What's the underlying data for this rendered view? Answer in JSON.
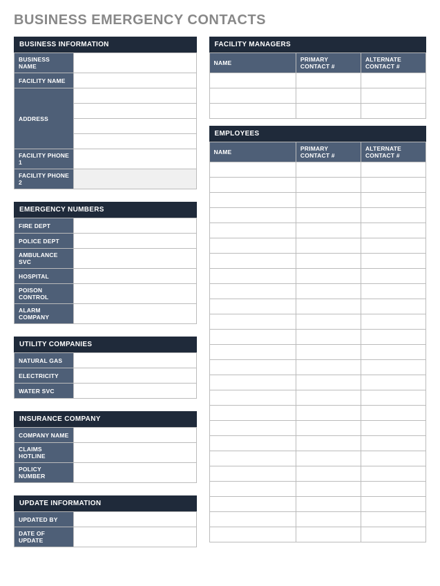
{
  "page_title": "BUSINESS EMERGENCY CONTACTS",
  "left": {
    "business_info": {
      "header": "BUSINESS INFORMATION",
      "rows": [
        {
          "label": "BUSINESS NAME",
          "value": ""
        },
        {
          "label": "FACILITY NAME",
          "value": ""
        },
        {
          "label": "ADDRESS",
          "value": [
            "",
            "",
            "",
            ""
          ]
        },
        {
          "label": "FACILITY PHONE 1",
          "value": ""
        },
        {
          "label": "FACILITY PHONE 2",
          "value": "",
          "shaded": true
        }
      ]
    },
    "emergency_numbers": {
      "header": "EMERGENCY NUMBERS",
      "rows": [
        {
          "label": "FIRE DEPT",
          "value": ""
        },
        {
          "label": "POLICE DEPT",
          "value": ""
        },
        {
          "label": "AMBULANCE SVC",
          "value": ""
        },
        {
          "label": "HOSPITAL",
          "value": ""
        },
        {
          "label": "POISON CONTROL",
          "value": ""
        },
        {
          "label": "ALARM COMPANY",
          "value": ""
        }
      ]
    },
    "utility_companies": {
      "header": "UTILITY COMPANIES",
      "rows": [
        {
          "label": "NATURAL GAS",
          "value": ""
        },
        {
          "label": "ELECTRICITY",
          "value": ""
        },
        {
          "label": "WATER SVC",
          "value": ""
        }
      ]
    },
    "insurance_company": {
      "header": "INSURANCE COMPANY",
      "rows": [
        {
          "label": "COMPANY NAME",
          "value": ""
        },
        {
          "label": "CLAIMS HOTLINE",
          "value": ""
        },
        {
          "label": "POLICY NUMBER",
          "value": ""
        }
      ]
    },
    "update_information": {
      "header": "UPDATE INFORMATION",
      "rows": [
        {
          "label": "UPDATED BY",
          "value": ""
        },
        {
          "label": "DATE OF UPDATE",
          "value": ""
        }
      ]
    }
  },
  "right": {
    "facility_managers": {
      "header": "FACILITY MANAGERS",
      "columns": [
        "NAME",
        "PRIMARY CONTACT #",
        "ALTERNATE CONTACT #"
      ],
      "rows": [
        [
          "",
          "",
          ""
        ],
        [
          "",
          "",
          ""
        ],
        [
          "",
          "",
          ""
        ]
      ]
    },
    "employees": {
      "header": "EMPLOYEES",
      "columns": [
        "NAME",
        "PRIMARY CONTACT #",
        "ALTERNATE CONTACT #"
      ],
      "rows": [
        [
          "",
          "",
          ""
        ],
        [
          "",
          "",
          ""
        ],
        [
          "",
          "",
          ""
        ],
        [
          "",
          "",
          ""
        ],
        [
          "",
          "",
          ""
        ],
        [
          "",
          "",
          ""
        ],
        [
          "",
          "",
          ""
        ],
        [
          "",
          "",
          ""
        ],
        [
          "",
          "",
          ""
        ],
        [
          "",
          "",
          ""
        ],
        [
          "",
          "",
          ""
        ],
        [
          "",
          "",
          ""
        ],
        [
          "",
          "",
          ""
        ],
        [
          "",
          "",
          ""
        ],
        [
          "",
          "",
          ""
        ],
        [
          "",
          "",
          ""
        ],
        [
          "",
          "",
          ""
        ],
        [
          "",
          "",
          ""
        ],
        [
          "",
          "",
          ""
        ],
        [
          "",
          "",
          ""
        ],
        [
          "",
          "",
          ""
        ],
        [
          "",
          "",
          ""
        ],
        [
          "",
          "",
          ""
        ],
        [
          "",
          "",
          ""
        ],
        [
          "",
          "",
          ""
        ]
      ]
    }
  }
}
